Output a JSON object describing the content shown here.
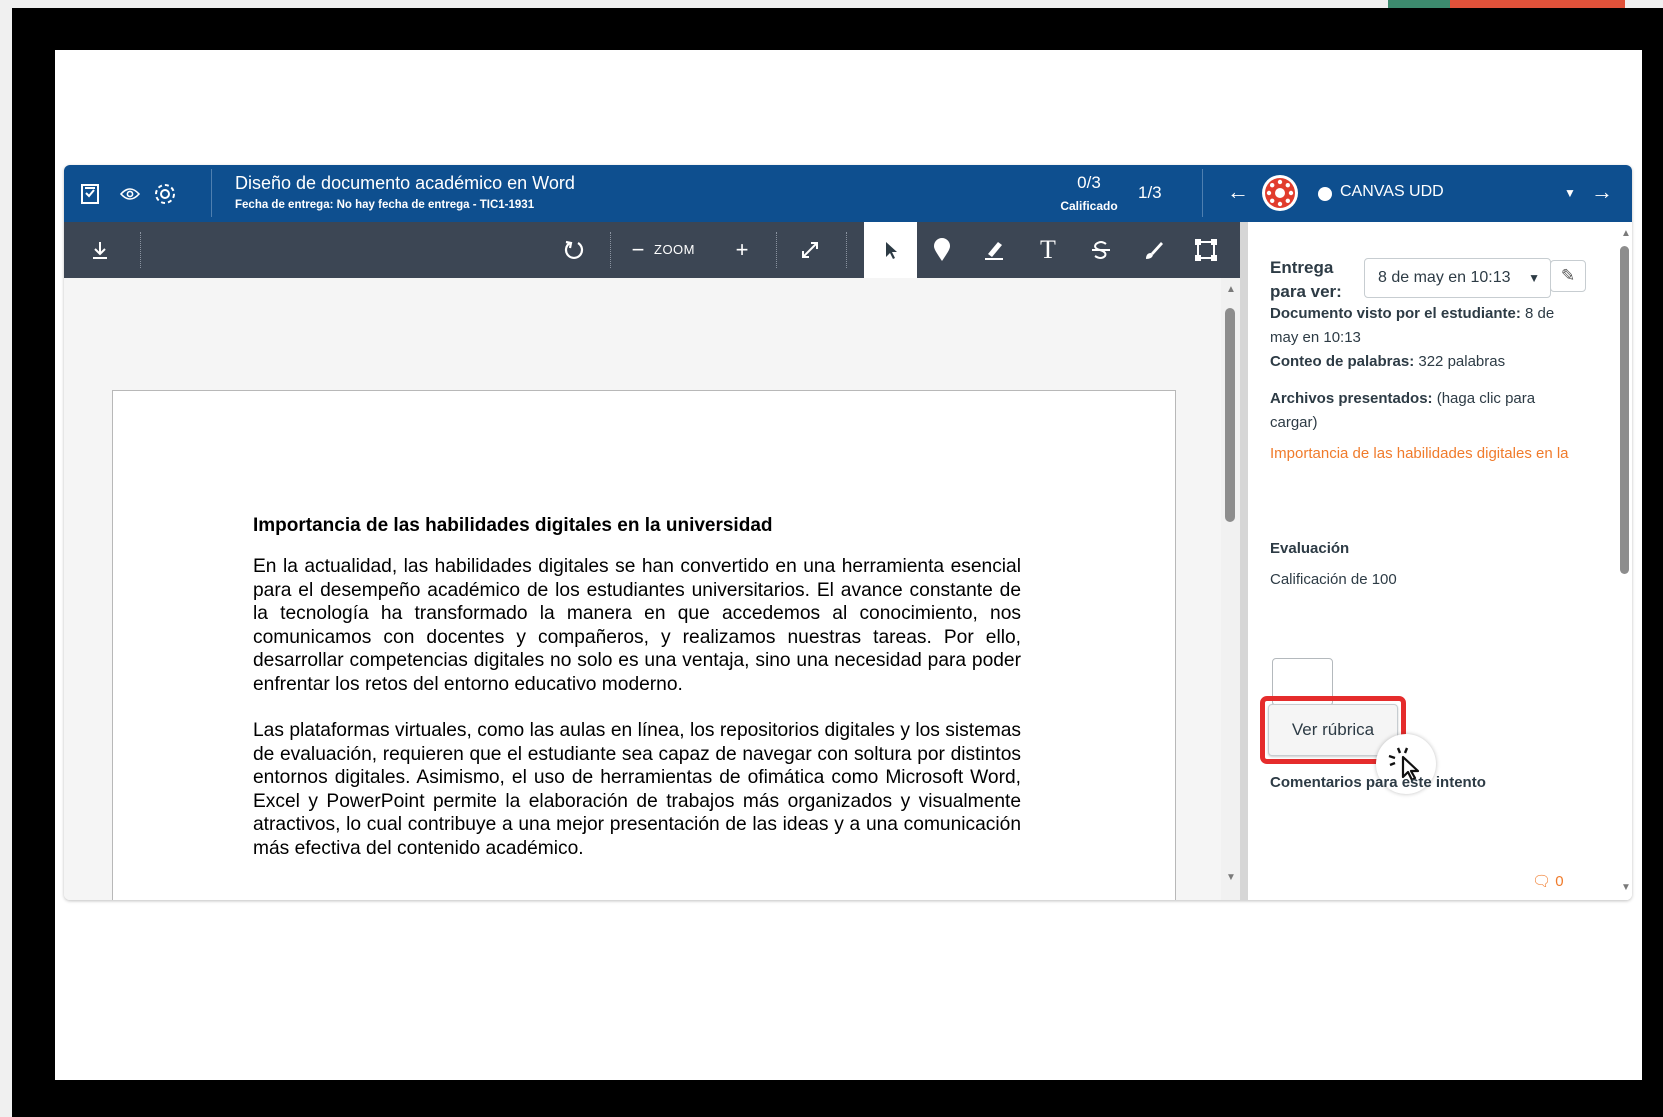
{
  "topbar": {
    "assignment_title": "Diseño de documento académico en Word",
    "due_line": "Fecha de entrega: No hay fecha de entrega - TIC1-1931",
    "score": "0/3",
    "score_label": "Calificado",
    "position": "1/3",
    "student_name": "CANVAS UDD",
    "icons": [
      "gradebook-icon",
      "eye-icon",
      "gear-icon",
      "arrow-left-icon",
      "arrow-right-icon"
    ]
  },
  "toolbar": {
    "zoom_label": "ZOOM",
    "icons": [
      "download-icon",
      "rotate-icon",
      "zoom-out-icon",
      "zoom-in-icon",
      "fullscreen-icon",
      "select-pointer-icon",
      "point-pin-icon",
      "highlight-icon",
      "text-icon",
      "strikeout-icon",
      "draw-icon",
      "area-icon"
    ]
  },
  "document": {
    "heading": "Importancia de las habilidades digitales en la universidad",
    "paragraphs": [
      "En la actualidad, las habilidades digitales se han convertido en una herramienta esencial para el desempeño académico de los estudiantes universitarios. El avance constante de la tecnología ha transformado la manera en que accedemos al conocimiento, nos comunicamos con docentes y compañeros, y realizamos nuestras tareas. Por ello, desarrollar competencias digitales no solo es una ventaja, sino una necesidad para poder enfrentar los retos del entorno educativo moderno.",
      "Las plataformas virtuales, como las aulas en línea, los repositorios digitales y los sistemas de evaluación, requieren que el estudiante sea capaz de navegar con soltura por distintos entornos digitales. Asimismo, el uso de herramientas de ofimática como Microsoft Word, Excel y PowerPoint permite la elaboración de trabajos más organizados y visualmente atractivos, lo cual contribuye a una mejor presentación de las ideas y a una comunicación más efectiva del contenido académico."
    ]
  },
  "panel": {
    "submission_label": "Entrega para ver:",
    "submission_value": "8 de may en 10:13",
    "viewed_label": "Documento visto por el estudiante:",
    "viewed_value": " 8 de may en 10:13",
    "wordcount_label": "Conteo de palabras:",
    "wordcount_value": " 322 palabras",
    "files_label": "Archivos presentados:",
    "files_hint": " (haga clic para cargar)",
    "file_link": "Importancia de las habilidades digitales en la",
    "assessment_heading": "Evaluación",
    "grade_label": "Calificación de 100",
    "rubric_button": "Ver rúbrica",
    "comments_heading": "Comentarios para este intento",
    "comment_count": "0"
  },
  "colors": {
    "topbar": "#0e4f8f",
    "toolbar": "#3c4654",
    "link": "#f07b2b",
    "highlight": "#e52c2c"
  }
}
